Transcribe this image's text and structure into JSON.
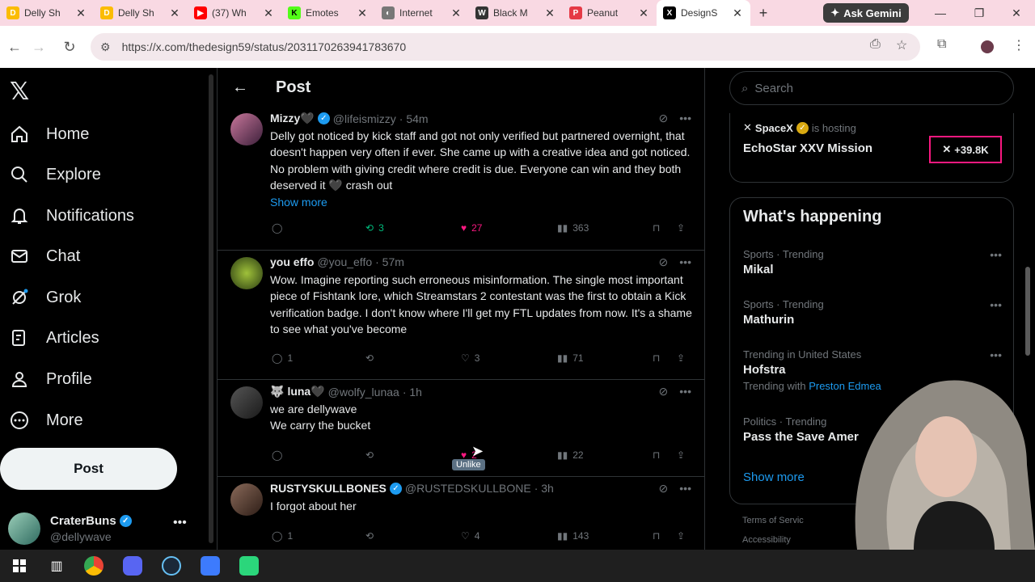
{
  "browser": {
    "tabs": [
      {
        "title": "Delly Sh",
        "color": "#fbbc04",
        "letter": "D"
      },
      {
        "title": "Delly Sh",
        "color": "#fbbc04",
        "letter": "D"
      },
      {
        "title": "(37) Wh",
        "color": "#ff0000",
        "letter": "▶"
      },
      {
        "title": "Emotes",
        "color": "#53fc18",
        "letter": "K"
      },
      {
        "title": "Internet",
        "color": "#777777",
        "letter": "◐"
      },
      {
        "title": "Black M",
        "color": "#333333",
        "letter": "W"
      },
      {
        "title": "Peanut",
        "color": "#e53945",
        "letter": "P"
      },
      {
        "title": "DesignS",
        "color": "#000000",
        "letter": "X"
      }
    ],
    "gemini_label": "Ask Gemini",
    "url": "https://x.com/thedesign59/status/2031170263941783670"
  },
  "nav": {
    "items": [
      {
        "label": "Home",
        "icon": "home-icon"
      },
      {
        "label": "Explore",
        "icon": "search-icon"
      },
      {
        "label": "Notifications",
        "icon": "bell-icon"
      },
      {
        "label": "Chat",
        "icon": "mail-icon"
      },
      {
        "label": "Grok",
        "icon": "grok-icon"
      },
      {
        "label": "Articles",
        "icon": "articles-icon"
      },
      {
        "label": "Profile",
        "icon": "person-icon"
      },
      {
        "label": "More",
        "icon": "more-circle-icon"
      }
    ],
    "post_label": "Post",
    "profile": {
      "name": "CraterBuns",
      "handle": "@dellywave"
    }
  },
  "center": {
    "title": "Post",
    "tweets": [
      {
        "name": "Mizzy🖤",
        "handle": "@lifeismizzy",
        "time": "· 54m",
        "verified": "blue",
        "text": "Delly got noticed by kick staff and got not only verified but partnered overnight, that doesn't happen very often if ever. She came up with a creative idea and got noticed. No problem with giving credit where credit is due. Everyone can win and they both deserved it 🖤 crash out",
        "show_more": "Show more",
        "replies": "",
        "reposts": "3",
        "likes": "27",
        "views": "363"
      },
      {
        "name": "you effo",
        "handle": "@you_effo",
        "time": "· 57m",
        "verified": "",
        "text": "Wow. Imagine reporting such erroneous misinformation. The single most important piece of Fishtank lore, which Streamstars 2 contestant was the first to obtain a Kick verification badge. I don't know where I'll get my FTL updates from now. It's a shame to see what you've become",
        "replies": "1",
        "reposts": "",
        "likes": "3",
        "views": "71"
      },
      {
        "name": "luna🖤",
        "handle": "@wolfy_lunaa",
        "time": "· 1h",
        "verified": "",
        "text_line1": "we are dellywave",
        "text_line2": "We carry the bucket",
        "replies": "",
        "reposts": "",
        "likes": "2",
        "views": "22",
        "tooltip": "Unlike"
      },
      {
        "name": "RUSTYSKULLBONES",
        "handle": "@RUSTEDSKULLBONE",
        "time": "· 3h",
        "verified": "blue",
        "text": "I forgot about her",
        "replies": "1",
        "reposts": "",
        "likes": "4",
        "views": "143"
      }
    ]
  },
  "right": {
    "search_placeholder": "Search",
    "space": {
      "host": "SpaceX",
      "hosting": "is hosting",
      "title": "EchoStar XXV Mission",
      "count": "+39.8K"
    },
    "trends_title": "What's happening",
    "trends": [
      {
        "meta": "Sports · Trending",
        "topic": "Mikal"
      },
      {
        "meta": "Sports · Trending",
        "topic": "Mathurin"
      },
      {
        "meta": "Trending in United States",
        "topic": "Hofstra",
        "with_label": "Trending with",
        "with_value": "Preston Edmea"
      },
      {
        "meta": "Politics · Trending",
        "topic": "Pass the Save Amer"
      }
    ],
    "show_more": "Show more",
    "footer1": "Terms of Servic",
    "footer2": "Accessibility"
  },
  "colors": {
    "accent": "#1d9bf0",
    "like": "#f91880",
    "repost": "#00ba7c",
    "space_border": "#f91880"
  }
}
